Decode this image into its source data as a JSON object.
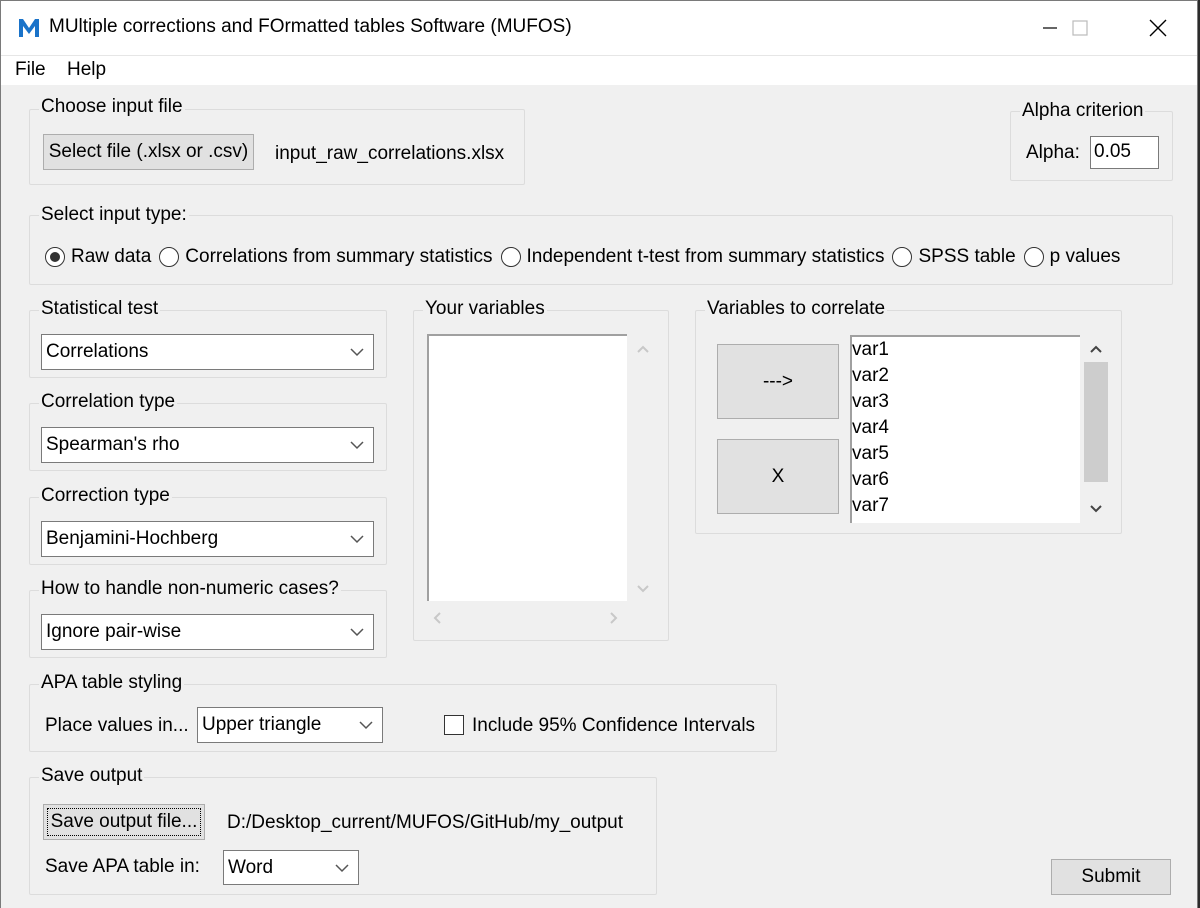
{
  "window": {
    "title": "MUltiple corrections and FOrmatted tables Software (MUFOS)",
    "app_icon_letter": "M",
    "accent_color": "#1a73c9"
  },
  "menu": {
    "items": [
      {
        "label": "File"
      },
      {
        "label": "Help"
      }
    ]
  },
  "input_file": {
    "group_label": "Choose input file",
    "select_button_label": "Select file (.xlsx or .csv)",
    "selected_file": "input_raw_correlations.xlsx"
  },
  "alpha": {
    "group_label": "Alpha criterion",
    "label": "Alpha:",
    "value": "0.05"
  },
  "input_type": {
    "group_label": "Select input type:",
    "options": [
      {
        "label": "Raw data",
        "selected": true
      },
      {
        "label": "Correlations from summary statistics",
        "selected": false
      },
      {
        "label": "Independent t-test from summary statistics",
        "selected": false
      },
      {
        "label": "SPSS table",
        "selected": false
      },
      {
        "label": "p values",
        "selected": false
      }
    ]
  },
  "statistical_test": {
    "group_label": "Statistical test",
    "selected": "Correlations"
  },
  "correlation_type": {
    "group_label": "Correlation type",
    "selected": "Spearman's rho"
  },
  "correction_type": {
    "group_label": "Correction type",
    "selected": "Benjamini-Hochberg"
  },
  "non_numeric": {
    "group_label": "How to handle non-numeric cases?",
    "selected": "Ignore pair-wise"
  },
  "your_variables": {
    "group_label": "Your variables",
    "items": []
  },
  "variables_to_correlate": {
    "group_label": "Variables to correlate",
    "add_button_label": "--->",
    "remove_button_label": "X",
    "items": [
      "var1",
      "var2",
      "var3",
      "var4",
      "var5",
      "var6",
      "var7"
    ]
  },
  "apa_styling": {
    "group_label": "APA table styling",
    "place_values_label": "Place values in...",
    "place_values_selected": "Upper triangle",
    "ci_checkbox_label": "Include 95% Confidence Intervals",
    "ci_checked": false
  },
  "save_output": {
    "group_label": "Save output",
    "save_button_label": "Save output file...",
    "output_path": "D:/Desktop_current/MUFOS/GitHub/my_output",
    "format_label": "Save APA table in:",
    "format_selected": "Word"
  },
  "submit_label": "Submit"
}
